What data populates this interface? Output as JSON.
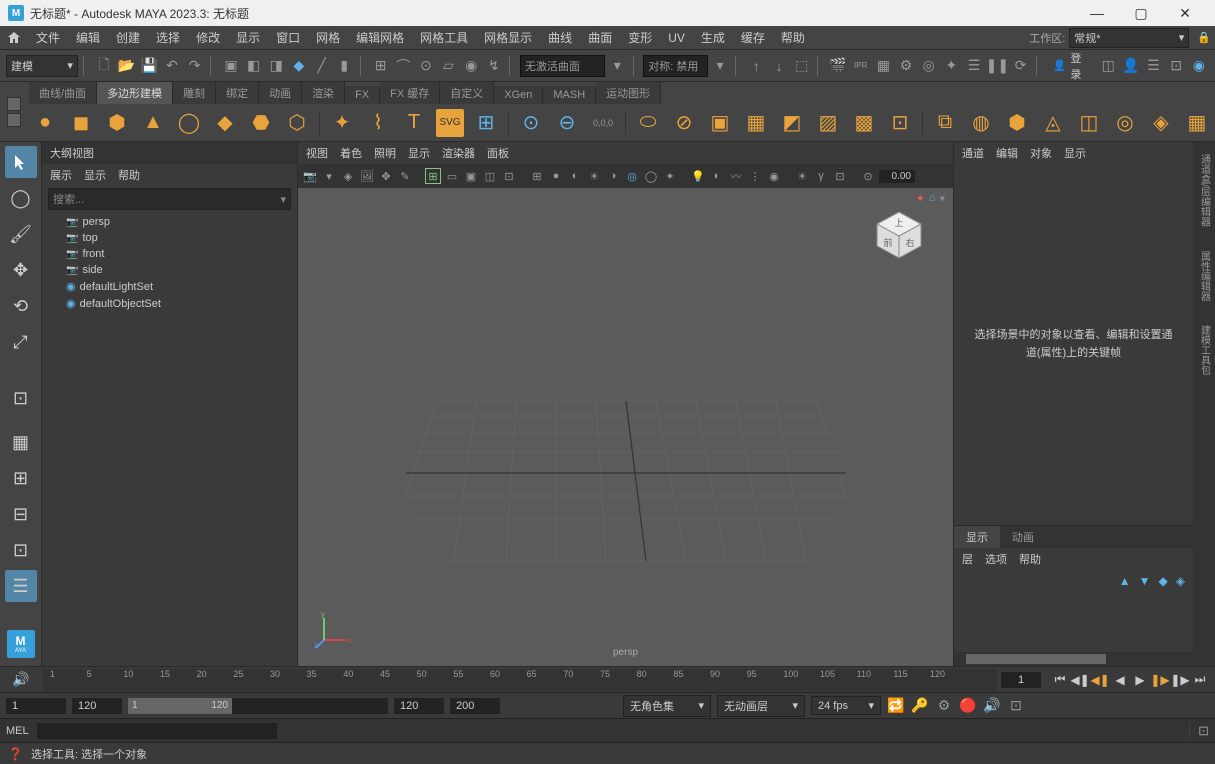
{
  "titlebar": {
    "maya_badge": "M",
    "title": "无标题* - Autodesk MAYA 2023.3: 无标题"
  },
  "menubar": {
    "items": [
      "文件",
      "编辑",
      "创建",
      "选择",
      "修改",
      "显示",
      "窗口",
      "网格",
      "编辑网格",
      "网格工具",
      "网格显示",
      "曲线",
      "曲面",
      "变形",
      "UV",
      "生成",
      "缓存",
      "帮助"
    ],
    "workspace_label": "工作区:",
    "workspace_value": "常规*"
  },
  "statusline": {
    "mode": "建模",
    "no_active_surface": "无激活曲面",
    "symmetry": "对称: 禁用",
    "login": "登录"
  },
  "shelf": {
    "tabs": [
      "曲线/曲面",
      "多边形建模",
      "雕刻",
      "绑定",
      "动画",
      "渲染",
      "FX",
      "FX 缓存",
      "自定义",
      "XGen",
      "MASH",
      "运动图形"
    ],
    "active_tab": 1
  },
  "outliner": {
    "title": "大纲视图",
    "menu": [
      "展示",
      "显示",
      "帮助"
    ],
    "search_placeholder": "搜索...",
    "items": [
      {
        "type": "cam",
        "label": "persp"
      },
      {
        "type": "cam",
        "label": "top"
      },
      {
        "type": "cam",
        "label": "front"
      },
      {
        "type": "cam",
        "label": "side"
      },
      {
        "type": "set",
        "label": "defaultLightSet"
      },
      {
        "type": "set",
        "label": "defaultObjectSet"
      }
    ]
  },
  "viewport": {
    "menu": [
      "视图",
      "着色",
      "照明",
      "显示",
      "渲染器",
      "面板"
    ],
    "exposure": "0.00",
    "cam_label": "persp"
  },
  "channelbox": {
    "menu": [
      "通道",
      "编辑",
      "对象",
      "显示"
    ],
    "empty_text": "选择场景中的对象以查看、编辑和设置通道(属性)上的关键帧",
    "layer_tabs": [
      "显示",
      "动画"
    ],
    "layer_menu": [
      "层",
      "选项",
      "帮助"
    ]
  },
  "sidebar_tabs": [
    "通道盒/层编辑器",
    "属性编辑器",
    "建模工具包"
  ],
  "timeslider": {
    "ticks": [
      1,
      5,
      10,
      15,
      20,
      25,
      30,
      35,
      40,
      45,
      50,
      55,
      60,
      65,
      70,
      75,
      80,
      85,
      90,
      95,
      100,
      105,
      110,
      115,
      120
    ],
    "current_frame": "1"
  },
  "rangeslider": {
    "start": "1",
    "end": "120",
    "range_start": "1",
    "range_end": "120",
    "playback_start": "120",
    "playback_end": "200",
    "charset": "无角色集",
    "animlayer": "无动画层",
    "fps": "24 fps"
  },
  "cmdline": {
    "label": "MEL"
  },
  "helpline": {
    "text": "选择工具: 选择一个对象"
  }
}
